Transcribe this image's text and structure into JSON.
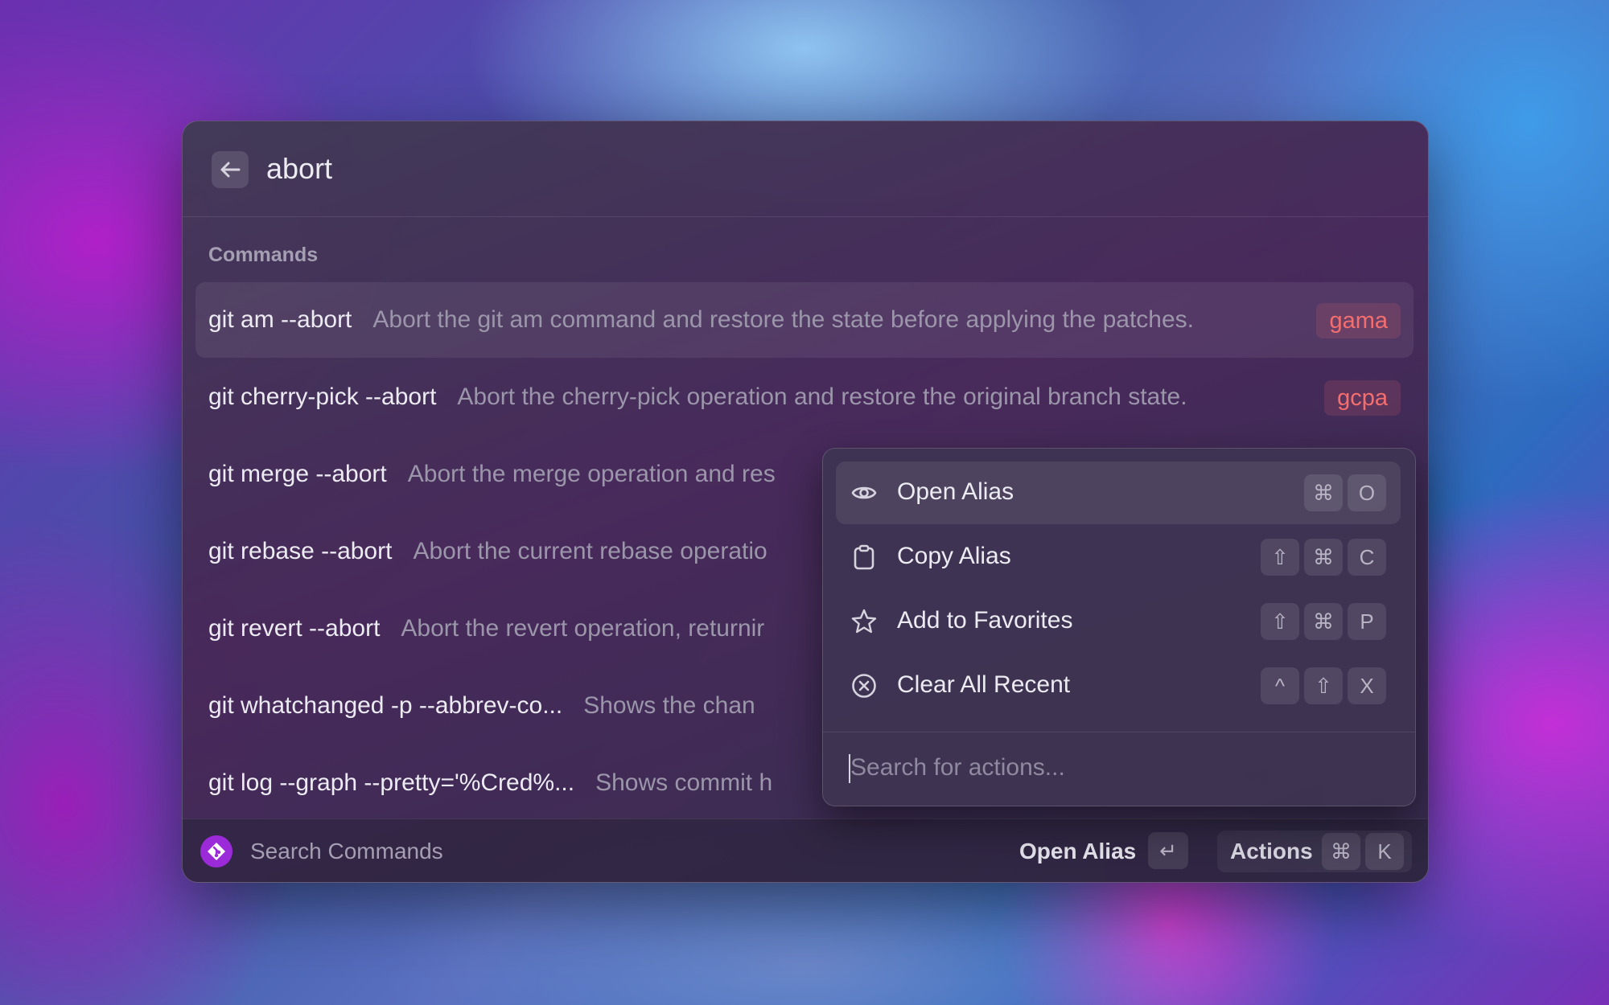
{
  "search": {
    "query": "abort"
  },
  "section_title": "Commands",
  "commands": [
    {
      "command": "git am --abort",
      "description": "Abort the git am command and restore the state before applying the patches.",
      "alias": "gama"
    },
    {
      "command": "git cherry-pick --abort",
      "description": "Abort the cherry-pick operation and restore the original branch state.",
      "alias": "gcpa"
    },
    {
      "command": "git merge --abort",
      "description": "Abort the merge operation and res"
    },
    {
      "command": "git rebase --abort",
      "description": "Abort the current rebase operatio"
    },
    {
      "command": "git revert --abort",
      "description": "Abort the revert operation, returnir"
    },
    {
      "command": "git whatchanged -p --abbrev-co...",
      "description": "Shows the chan"
    },
    {
      "command": "git log --graph --pretty='%Cred%...",
      "description": "Shows commit h"
    }
  ],
  "footer": {
    "search_label": "Search Commands",
    "primary_action": "Open Alias",
    "primary_key": "↵",
    "actions_label": "Actions",
    "actions_keys": [
      "⌘",
      "K"
    ]
  },
  "action_menu": {
    "items": [
      {
        "label": "Open Alias",
        "icon": "eye-icon",
        "keys": [
          "⌘",
          "O"
        ]
      },
      {
        "label": "Copy Alias",
        "icon": "clipboard-icon",
        "keys": [
          "⇧",
          "⌘",
          "C"
        ]
      },
      {
        "label": "Add to Favorites",
        "icon": "star-icon",
        "keys": [
          "⇧",
          "⌘",
          "P"
        ]
      },
      {
        "label": "Clear All Recent",
        "icon": "clear-circle-icon",
        "keys": [
          "^",
          "⇧",
          "X"
        ]
      }
    ],
    "search_placeholder": "Search for actions..."
  },
  "colors": {
    "alias_text": "#f36f6f",
    "extension_icon": "#9b2bd8"
  }
}
